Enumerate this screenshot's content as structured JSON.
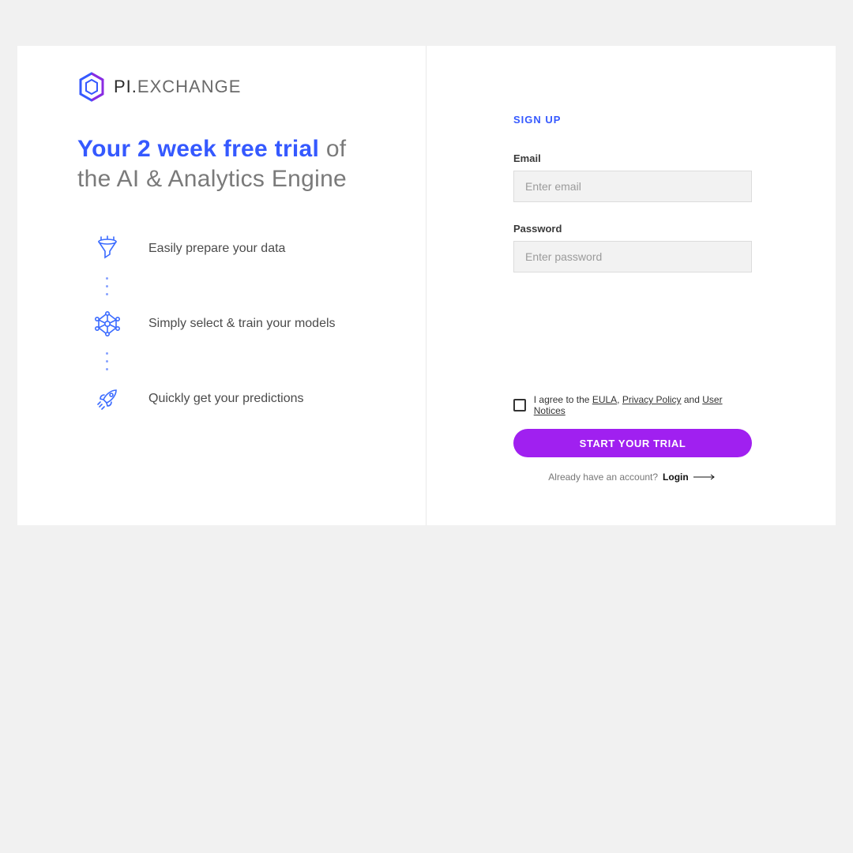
{
  "brand": {
    "name_strong": "PI.",
    "name_light": "EXCHANGE"
  },
  "headline": {
    "accent": "Your 2 week free trial",
    "rest1": " of",
    "rest2": "the AI & Analytics Engine"
  },
  "features": [
    {
      "label": "Easily prepare your data",
      "icon": "funnel-icon"
    },
    {
      "label": "Simply select & train your models",
      "icon": "network-icon"
    },
    {
      "label": "Quickly get your predictions",
      "icon": "rocket-icon"
    }
  ],
  "form": {
    "title": "SIGN UP",
    "email_label": "Email",
    "email_placeholder": "Enter email",
    "password_label": "Password",
    "password_placeholder": "Enter password",
    "agree_prefix": "I agree to the ",
    "eula": "EULA",
    "sep1": ", ",
    "privacy": "Privacy Policy",
    "sep2": " and ",
    "notices": "User Notices",
    "cta": "START YOUR TRIAL",
    "already": "Already have an account?",
    "login": "Login"
  }
}
